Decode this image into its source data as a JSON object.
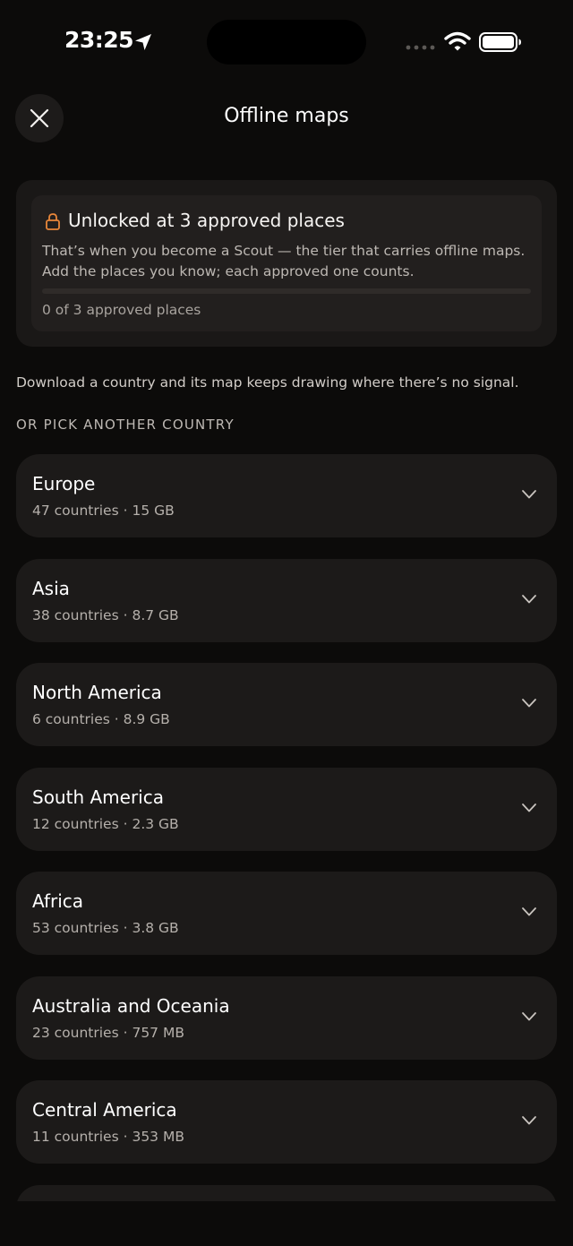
{
  "status_bar": {
    "time": "23:25"
  },
  "header": {
    "title": "Offline maps"
  },
  "locked_panel": {
    "title": "Unlocked at 3 approved places",
    "description": "That’s when you become a Scout — the tier that carries offline maps. Add the places you know; each approved one counts.",
    "progress_text": "0 of 3 approved places",
    "progress_value": 0,
    "progress_max": 3,
    "accent_color": "#e8863a"
  },
  "intro_text": "Download a country and its map keeps drawing where there’s no signal.",
  "section_header": "OR PICK ANOTHER COUNTRY",
  "regions": [
    {
      "name": "Europe",
      "meta": "47 countries · 15 GB"
    },
    {
      "name": "Asia",
      "meta": "38 countries · 8.7 GB"
    },
    {
      "name": "North America",
      "meta": "6 countries · 8.9 GB"
    },
    {
      "name": "South America",
      "meta": "12 countries · 2.3 GB"
    },
    {
      "name": "Africa",
      "meta": "53 countries · 3.8 GB"
    },
    {
      "name": "Australia and Oceania",
      "meta": "23 countries · 757 MB"
    },
    {
      "name": "Central America",
      "meta": "11 countries · 353 MB"
    },
    {
      "name": "",
      "meta": ""
    }
  ]
}
